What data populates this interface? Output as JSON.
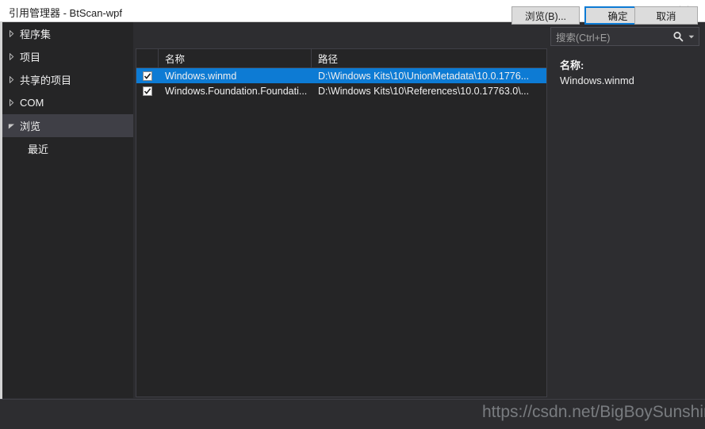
{
  "window": {
    "title": "引用管理器 - BtScan-wpf",
    "help_icon": "question-mark-icon",
    "close_icon": "close-icon"
  },
  "sidebar": {
    "items": [
      {
        "label": "程序集",
        "expanded": false,
        "selected": false,
        "child": false
      },
      {
        "label": "项目",
        "expanded": false,
        "selected": false,
        "child": false
      },
      {
        "label": "共享的项目",
        "expanded": false,
        "selected": false,
        "child": false
      },
      {
        "label": "COM",
        "expanded": false,
        "selected": false,
        "child": false
      },
      {
        "label": "浏览",
        "expanded": true,
        "selected": true,
        "child": false
      },
      {
        "label": "最近",
        "expanded": false,
        "selected": false,
        "child": true
      }
    ]
  },
  "list": {
    "columns": {
      "name": "名称",
      "path": "路径"
    },
    "rows": [
      {
        "checked": true,
        "selected": true,
        "name": "Windows.winmd",
        "path": "D:\\Windows Kits\\10\\UnionMetadata\\10.0.1776..."
      },
      {
        "checked": true,
        "selected": false,
        "name": "Windows.Foundation.Foundati...",
        "path": "D:\\Windows Kits\\10\\References\\10.0.17763.0\\..."
      }
    ]
  },
  "search": {
    "placeholder": "搜索(Ctrl+E)",
    "value": "",
    "icon": "search-icon",
    "dropdown_icon": "chevron-down-icon"
  },
  "detail": {
    "name_label": "名称:",
    "name_value": "Windows.winmd"
  },
  "footer": {
    "browse_label": "浏览(B)...",
    "ok_label": "确定",
    "cancel_label": "取消"
  },
  "watermark": {
    "text": "https://csdn.net/BigBoySunshine"
  },
  "colors": {
    "accent": "#0d7bd4",
    "window_bg": "#2d2d30",
    "panel_bg": "#252526",
    "border": "#3f3f46",
    "titlebar_bg": "#ffffff",
    "selected_sidebar": "#3f3f46",
    "button_face": "#dcdcdc"
  }
}
